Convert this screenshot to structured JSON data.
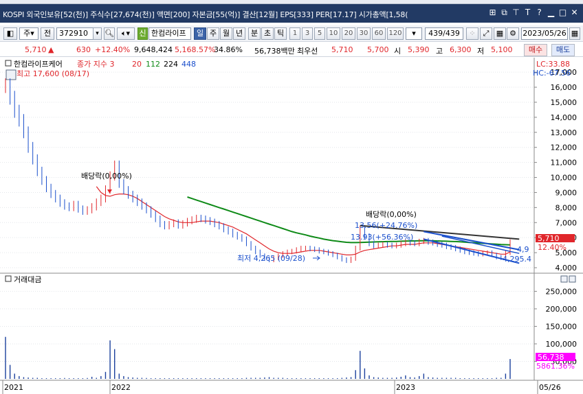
{
  "titlebar": {
    "text": "KOSPI 외국인보유[52(천)] 주식수[27,674(천)] 액면[200] 자본금[55(억)] 결산[12월] EPS[333] PER[17.17] 시가총액[1,58(",
    "icons": [
      "copy-icon",
      "restore-icon",
      "pin-icon",
      "text-icon",
      "help-icon",
      "minimize-icon",
      "maximize-icon",
      "close-icon"
    ]
  },
  "toolbar": {
    "market_select": "주",
    "period_label": "전",
    "code_value": "372910",
    "credit_label": "신",
    "stock_name": "한컴라이프",
    "periods": [
      "일",
      "주",
      "월",
      "년",
      "분",
      "초",
      "틱"
    ],
    "active_period": "일",
    "intervals": [
      "1",
      "3",
      "5",
      "10",
      "20",
      "30",
      "60",
      "120"
    ],
    "count_value": "439",
    "count_total": "/439",
    "date_value": "2023/05/26"
  },
  "quote": {
    "price": "5,710",
    "arrow": "▲",
    "change": "630",
    "change_pct": "+12.40%",
    "volume": "9,648,424",
    "volume_ratio": "5,168.57%",
    "turnover": "34.86%",
    "amount": "56,738백만",
    "best_label": "최우선",
    "ask": "5,710",
    "bid": "5,700",
    "open_label": "시",
    "open": "5,390",
    "high_label": "고",
    "high": "6,300",
    "low_label": "저",
    "low": "5,100",
    "buy_label": "매수",
    "sell_label": "매도"
  },
  "colors": {
    "title_bg": "#223a64",
    "up": "#e0262b",
    "down": "#1a4fcc",
    "ma3": "#e0262b",
    "ma20": "#0e8a17",
    "ma112": "#000000",
    "ma224": "#1a4fcc",
    "price_tag": "#e0262b",
    "amount_tag": "#ff00ff"
  },
  "chart_data": [
    {
      "type": "line",
      "legend": {
        "stock_name": "한컴라이프케어",
        "series_label": "종가 지수 3",
        "ma_20": "20",
        "ma_112": "112",
        "ma_224": "224",
        "ma_448": "448"
      },
      "y_ticks": [
        "17,000",
        "16,000",
        "15,000",
        "14,000",
        "13,000",
        "12,000",
        "11,000",
        "10,000",
        "9,000",
        "8,000",
        "7,000",
        "6,000",
        "5,000",
        "4,000"
      ],
      "ylim": [
        4000,
        17600
      ],
      "x_labels": [
        "2021",
        "2022",
        "2023",
        "05/26"
      ],
      "annotations": {
        "high": "최고 17,600 (08/17)",
        "low": "최저 4,265 (09/28)",
        "dividend_1": "배당락(0,00%)",
        "dividend_2": "배당락(0,00%)",
        "channel_top": "13.56(+24.76%)",
        "channel_mid": "13.93(+56.36%)",
        "right_label_1": "4,9",
        "right_label_2": "4,295.4"
      },
      "lc_label": "LC:33.88",
      "hc_label": "HC:-67.56",
      "last_price_tag": "5,710",
      "last_pct_tag": "12.40%",
      "close": [
        16100,
        15300,
        14400,
        13800,
        13000,
        12000,
        11200,
        10400,
        9800,
        9300,
        8900,
        8600,
        8300,
        8100,
        8000,
        8200,
        7900,
        7750,
        7850,
        8050,
        8350,
        8600,
        9200,
        10100,
        10800,
        9600,
        9150,
        8850,
        8600,
        8350,
        8100,
        7850,
        7550,
        7250,
        6900,
        6750,
        6900,
        7000,
        6800,
        6950,
        7100,
        7200,
        7300,
        7250,
        7150,
        7050,
        6900,
        6750,
        6550,
        6400,
        6200,
        6050,
        5900,
        5600,
        5300,
        5050,
        4800,
        4600,
        4500,
        4650,
        4800,
        4950,
        5050,
        5100,
        5200,
        5300,
        5300,
        5250,
        5200,
        5100,
        5050,
        4950,
        4850,
        4700,
        4550,
        4450,
        4600,
        5300,
        6600,
        6100,
        5600,
        5450,
        5500,
        5550,
        5500,
        5450,
        5500,
        5600,
        5700,
        5650,
        5600,
        5750,
        5800,
        5700,
        5650,
        5550,
        5500,
        5400,
        5350,
        5250,
        5150,
        5050,
        5000,
        4950,
        4900,
        4950,
        5000,
        4850,
        4700,
        4650,
        5000,
        5710
      ],
      "ma20": [
        null,
        null,
        null,
        null,
        null,
        null,
        null,
        null,
        null,
        null,
        null,
        null,
        null,
        null,
        null,
        null,
        null,
        null,
        null,
        null,
        9400,
        9000,
        8800,
        8750,
        8850,
        8900,
        8900,
        8850,
        8750,
        8600,
        8400,
        8200,
        8000,
        7800,
        7600,
        7400,
        7250,
        7150,
        7050,
        7000,
        7000,
        7000,
        7050,
        7100,
        7100,
        7100,
        7050,
        7000,
        6900,
        6800,
        6700,
        6550,
        6400,
        6250,
        6050,
        5850,
        5650,
        5450,
        5250,
        5100,
        5000,
        4950,
        4950,
        4950,
        5000,
        5050,
        5100,
        5150,
        5150,
        5150,
        5100,
        5050,
        5000,
        4950,
        4900,
        4850,
        4850,
        4900,
        5050,
        5150,
        5200,
        5250,
        5300,
        5350,
        5400,
        5450,
        5450,
        5500,
        5550,
        5550,
        5550,
        5600,
        5650,
        5650,
        5650,
        5600,
        5550,
        5500,
        5450,
        5400,
        5350,
        5300,
        5250,
        5200,
        5150,
        5100,
        5050,
        5000,
        4950,
        4900,
        4900,
        5050
      ],
      "ma112": [
        null,
        null,
        null,
        null,
        null,
        null,
        null,
        null,
        null,
        null,
        null,
        null,
        null,
        null,
        null,
        null,
        null,
        null,
        null,
        null,
        null,
        null,
        null,
        null,
        null,
        null,
        null,
        null,
        null,
        null,
        null,
        null,
        null,
        null,
        null,
        null,
        null,
        null,
        null,
        null,
        8700,
        8600,
        8500,
        8400,
        8300,
        8200,
        8100,
        8000,
        7900,
        7800,
        7700,
        7600,
        7500,
        7400,
        7300,
        7200,
        7100,
        7000,
        6900,
        6800,
        6700,
        6600,
        6500,
        6400,
        6320,
        6250,
        6180,
        6100,
        6030,
        5970,
        5900,
        5850,
        5800,
        5760,
        5720,
        5690,
        5670,
        5670,
        5680,
        5690,
        5700,
        5710,
        5720,
        5730,
        5740,
        5750,
        5750,
        5760,
        5770,
        5780,
        5780,
        5790,
        5790,
        5790,
        5790,
        5780,
        5770,
        5760,
        5750,
        5740,
        5720,
        5700,
        5680,
        5660,
        5640,
        5620,
        5600,
        5580,
        5560,
        5540,
        5530,
        5520
      ],
      "trend_line": [
        [
          78,
          6800
        ],
        [
          113,
          5900
        ]
      ],
      "channel_upper": [
        [
          92,
          6400
        ],
        [
          113,
          5200
        ]
      ],
      "channel_lower": [
        [
          92,
          5900
        ],
        [
          113,
          4300
        ]
      ],
      "channel_mid": [
        [
          96,
          6100
        ],
        [
          113,
          4950
        ]
      ]
    },
    {
      "type": "bar",
      "title": "거래대금",
      "y_ticks": [
        "250,000",
        "200,000",
        "150,000",
        "100,000",
        "50,000"
      ],
      "ylim": [
        0,
        290000
      ],
      "amount_tag": "56,738",
      "ratio_tag": "5861.36%",
      "values": [
        120000,
        40000,
        15000,
        8000,
        5000,
        4000,
        3000,
        3000,
        2000,
        2000,
        2000,
        2000,
        2000,
        2500,
        2000,
        2000,
        2000,
        2000,
        2500,
        6000,
        3000,
        8000,
        20000,
        110000,
        85000,
        15000,
        8000,
        5000,
        4000,
        3000,
        3000,
        2500,
        2000,
        2000,
        2000,
        2000,
        2000,
        2000,
        2000,
        2000,
        2000,
        2000,
        2000,
        2000,
        2000,
        2000,
        2000,
        2000,
        2000,
        2000,
        2000,
        2000,
        2000,
        3000,
        3000,
        3000,
        3000,
        4000,
        5000,
        3000,
        3000,
        3000,
        2000,
        2000,
        2000,
        2000,
        2000,
        2000,
        2000,
        2000,
        2000,
        2000,
        2000,
        2000,
        3000,
        4000,
        5000,
        25000,
        80000,
        30000,
        10000,
        5000,
        4000,
        3000,
        3000,
        3000,
        4000,
        6000,
        10000,
        5000,
        4000,
        8000,
        15000,
        5000,
        4000,
        3000,
        3000,
        3000,
        3000,
        3000,
        2000,
        2000,
        2000,
        2000,
        2000,
        2000,
        2000,
        2000,
        3000,
        3000,
        15000,
        56738
      ]
    }
  ]
}
